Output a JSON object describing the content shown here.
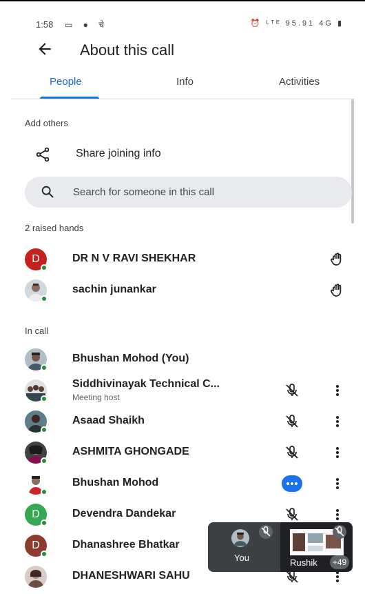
{
  "status_bar": {
    "time": "1:58",
    "left_icons": "▭ ● चे",
    "right_icons": "⏰ ᴸᵀᴱ 95.91 4G ▮"
  },
  "header": {
    "title": "About this call"
  },
  "tabs": [
    {
      "label": "People",
      "active": true
    },
    {
      "label": "Info",
      "active": false
    },
    {
      "label": "Activities",
      "active": false
    }
  ],
  "add_others": {
    "label": "Add others",
    "share_label": "Share joining info"
  },
  "search": {
    "placeholder": "Search for someone in this call"
  },
  "raised_hands": {
    "label": "2 raised hands",
    "people": [
      {
        "name": "DR N V RAVI SHEKHAR",
        "avatar": "D",
        "avatar_color": "#c5221f"
      },
      {
        "name": "sachin junankar",
        "avatar": "photo"
      }
    ]
  },
  "in_call": {
    "label": "In call",
    "people": [
      {
        "name": "Bhushan Mohod (You)",
        "avatar": "photo"
      },
      {
        "name": "Siddhivinayak Technical C...",
        "subtitle": "Meeting host",
        "avatar": "photo",
        "mic": "muted"
      },
      {
        "name": "Asaad Shaikh",
        "avatar": "photo",
        "mic": "muted"
      },
      {
        "name": "ASHMITA GHONGADE",
        "avatar": "photo",
        "mic": "muted"
      },
      {
        "name": "Bhushan Mohod",
        "avatar": "photo",
        "mic": "speaking"
      },
      {
        "name": "Devendra Dandekar",
        "avatar": "D",
        "avatar_color": "#34a853",
        "mic": "muted"
      },
      {
        "name": "Dhanashree Bhatkar",
        "avatar": "D",
        "avatar_color": "#8d3b2f",
        "mic": "muted"
      },
      {
        "name": "DHANESHWARI SAHU",
        "avatar": "photo",
        "mic": "muted"
      }
    ]
  },
  "pip": {
    "self_label": "You",
    "other_label": "Rushik",
    "count": "+49"
  },
  "colors": {
    "accent": "#1a73e8",
    "online": "#1e8e3e",
    "search_bg": "#e8eaed"
  }
}
